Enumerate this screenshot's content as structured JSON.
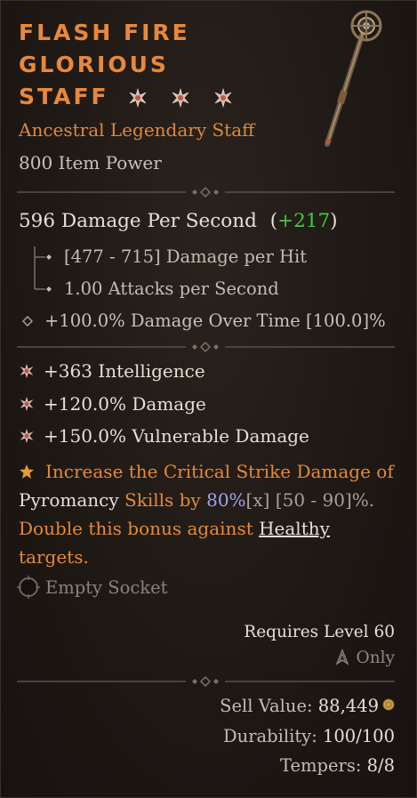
{
  "item": {
    "name_line1": "Flash Fire",
    "name_line2": "Glorious",
    "name_line3": "Staff",
    "rarity_type": "Ancestral Legendary Staff",
    "item_power": "800 Item Power",
    "name_color": "#e8883b"
  },
  "damage": {
    "dps_value": "596 Damage Per Second",
    "dps_paren_open": "(",
    "dps_bonus": "+217",
    "dps_paren_close": ")",
    "per_hit": "[477 - 715] Damage per Hit",
    "attacks": "1.00 Attacks per Second",
    "dot": "+100.0% Damage Over Time [100.0]%"
  },
  "affixes": [
    {
      "text": "+363 Intelligence",
      "icon": "affix-star-icon"
    },
    {
      "text": "+120.0% Damage",
      "icon": "affix-star-icon"
    },
    {
      "text": "+150.0% Vulnerable Damage",
      "icon": "affix-star-icon"
    }
  ],
  "legendary": {
    "part1": "Increase the Critical Strike Damage of",
    "part2": "Pyromancy",
    "part3": " Skills by ",
    "value": "80%",
    "mult": "[x]",
    "range": " [50 - 90]%.",
    "part4": "Double this bonus against ",
    "healthy": "Healthy",
    "part5": "targets."
  },
  "socket": {
    "label": "Empty Socket"
  },
  "requirements": {
    "level": "Requires Level 60",
    "class_only": "Only"
  },
  "stats": {
    "sell_label": "Sell Value:",
    "sell_value": "88,449",
    "durability_label": "Durability:",
    "durability_value": "100/100",
    "tempers_label": "Tempers:",
    "tempers_value": "8/8"
  },
  "colors": {
    "legendary_orange": "#e58a35",
    "bonus_green": "#3ecb3e",
    "value_blue": "#a6a2f0"
  }
}
